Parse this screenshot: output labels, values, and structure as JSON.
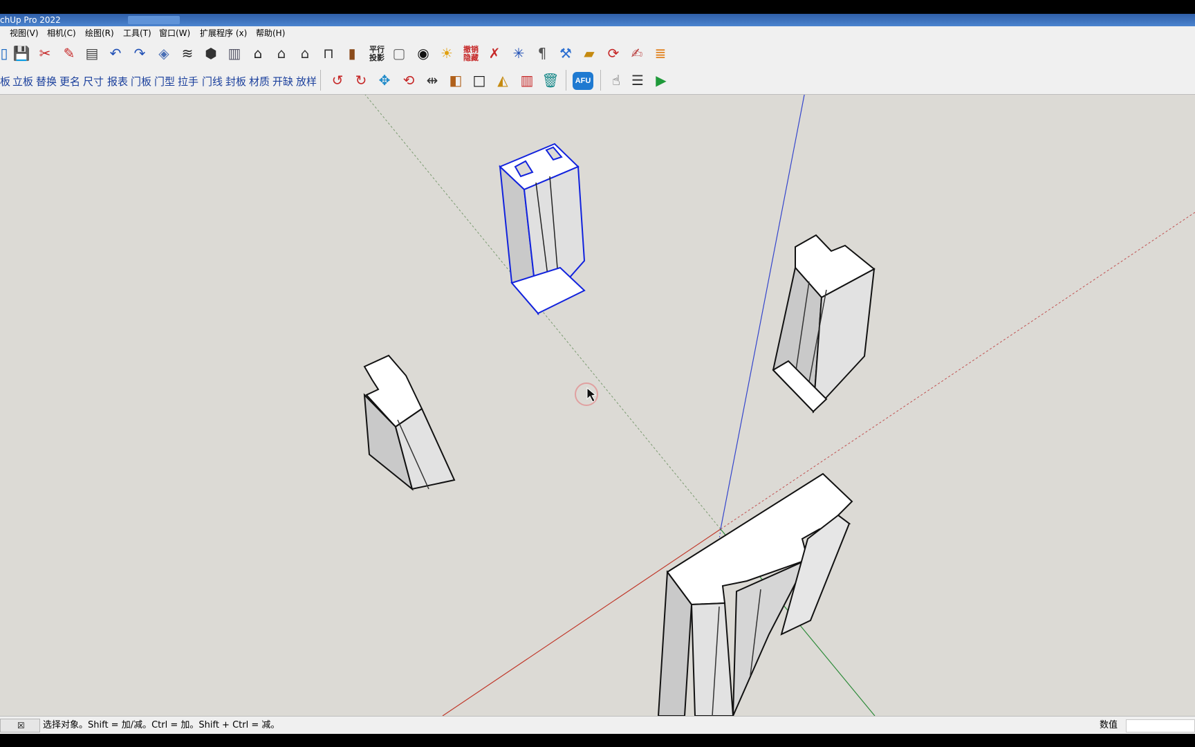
{
  "window": {
    "title": "chUp Pro 2022"
  },
  "menu": [
    "视图(V)",
    "相机(C)",
    "绘图(R)",
    "工具(T)",
    "窗口(W)",
    "扩展程序 (x)",
    "帮助(H)"
  ],
  "toolbar1": {
    "parallel_label": "平行\n投影",
    "hide_label": "撤销\n隐藏",
    "icons": [
      "new-icon",
      "save-icon",
      "cut-icon",
      "paint-icon",
      "page-icon",
      "undo-arrow-icon",
      "redo-arrow-icon",
      "eraser-icon",
      "layers-stack-icon",
      "box-icon",
      "door-panel-icon",
      "home-icon",
      "house-outline-icon",
      "house-simple-icon",
      "storefront-icon",
      "cabinet-icon",
      "parallel-projection-icon",
      "wireframe-box-icon",
      "eye-icon",
      "lightbulb-icon",
      "undo-hide-icon",
      "pin-icon",
      "axes-icon",
      "pilcrow-icon",
      "brush-icon",
      "folder-open-icon",
      "refresh-icon",
      "rb-note-icon",
      "layers-icon"
    ]
  },
  "toolbar2": {
    "plugin_labels": [
      "板",
      "立板",
      "替换",
      "更名",
      "尺寸",
      "报表",
      "门板",
      "门型",
      "拉手",
      "门线",
      "封板",
      "材质",
      "开缺",
      "放样"
    ],
    "afu_label": "AFU"
  },
  "status": {
    "message": "选择对象。Shift = 加/减。Ctrl = 加。Shift + Ctrl = 减。",
    "value_label": "数值",
    "value": ""
  },
  "colors": {
    "viewport_bg": "#dcdad5",
    "axis_red": "#c0392b",
    "axis_green": "#2e8b3a",
    "axis_blue": "#3344cc",
    "selection_blue": "#1122dd"
  }
}
